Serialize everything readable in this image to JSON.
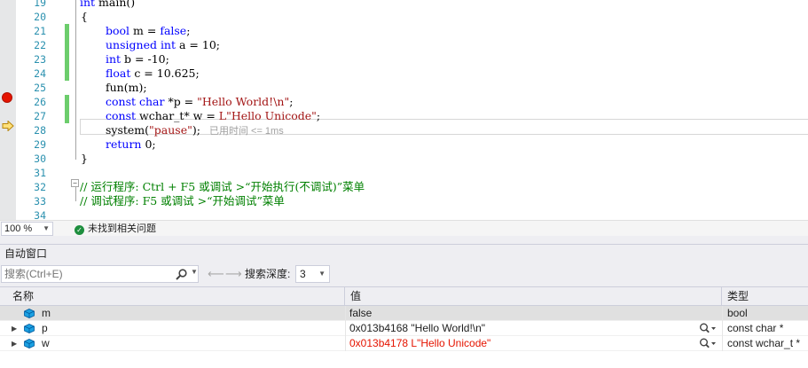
{
  "editor": {
    "lines": [
      {
        "num": "19",
        "tokens": [
          {
            "t": "int",
            "c": "kw"
          },
          {
            "t": " main()"
          }
        ]
      },
      {
        "num": "20",
        "tokens": [
          {
            "t": "{"
          }
        ]
      },
      {
        "num": "21",
        "tokens": [
          {
            "t": "bool",
            "c": "kw"
          },
          {
            "t": " m = "
          },
          {
            "t": "false",
            "c": "kw"
          },
          {
            "t": ";"
          }
        ]
      },
      {
        "num": "22",
        "tokens": [
          {
            "t": "unsigned int",
            "c": "kw"
          },
          {
            "t": " a = 10;"
          }
        ]
      },
      {
        "num": "23",
        "tokens": [
          {
            "t": "int",
            "c": "kw"
          },
          {
            "t": " b = -10;"
          }
        ]
      },
      {
        "num": "24",
        "tokens": [
          {
            "t": "float",
            "c": "kw"
          },
          {
            "t": " c = 10.625;"
          }
        ]
      },
      {
        "num": "25",
        "tokens": [
          {
            "t": "fun(m);"
          }
        ]
      },
      {
        "num": "26",
        "tokens": [
          {
            "t": "const char",
            "c": "kw"
          },
          {
            "t": " *p = "
          },
          {
            "t": "\"Hello World!\\n\"",
            "c": "str"
          },
          {
            "t": ";"
          }
        ]
      },
      {
        "num": "27",
        "tokens": [
          {
            "t": "const",
            "c": "kw"
          },
          {
            "t": " wchar_t* w = "
          },
          {
            "t": "L\"Hello Unicode\"",
            "c": "str"
          },
          {
            "t": ";"
          }
        ]
      },
      {
        "num": "28",
        "tokens": [
          {
            "t": "system("
          },
          {
            "t": "\"pause\"",
            "c": "str"
          },
          {
            "t": ");"
          }
        ]
      },
      {
        "num": "29",
        "tokens": [
          {
            "t": "return",
            "c": "kw"
          },
          {
            "t": " 0;"
          }
        ]
      },
      {
        "num": "30",
        "tokens": [
          {
            "t": "}"
          }
        ]
      },
      {
        "num": "31",
        "tokens": []
      },
      {
        "num": "32",
        "tokens": [
          {
            "t": "// 运行程序: Ctrl + F5 或调试 >“开始执行(不调试)”菜单"
          }
        ]
      },
      {
        "num": "33",
        "tokens": [
          {
            "t": "// 调试程序: F5 或调试 >“开始调试”菜单"
          }
        ]
      },
      {
        "num": "34",
        "tokens": []
      }
    ],
    "perf_tip": "已用时间 <= 1ms"
  },
  "status": {
    "zoom": "100 %",
    "issues": "未找到相关问题"
  },
  "autos": {
    "title": "自动窗口",
    "search_placeholder": "搜索(Ctrl+E)",
    "depth_label": "搜索深度:",
    "depth_value": "3",
    "columns": {
      "name": "名称",
      "value": "值",
      "type": "类型"
    },
    "rows": [
      {
        "name": "m",
        "value": "false",
        "type": "bool",
        "expandable": false,
        "changed": false,
        "viewer": false
      },
      {
        "name": "p",
        "value": "0x013b4168 \"Hello World!\\n\"",
        "type": "const char *",
        "expandable": true,
        "changed": false,
        "viewer": true
      },
      {
        "name": "w",
        "value": "0x013b4178 L\"Hello Unicode\"",
        "type": "const wchar_t *",
        "expandable": true,
        "changed": true,
        "viewer": true
      }
    ]
  },
  "colors": {
    "keyword": "#0000ff",
    "string": "#a31515",
    "comment": "#008000",
    "line_number": "#2b91af",
    "changed_value": "#e51400",
    "change_bar": "#6ccd6c",
    "breakpoint": "#e51400"
  },
  "icons": {
    "breakpoint": "breakpoint-icon",
    "current_statement": "execution-arrow-icon",
    "no_issues": "check-circle-icon",
    "search": "search-icon",
    "variable": "variable-cube-icon",
    "viewer": "magnifier-icon"
  }
}
